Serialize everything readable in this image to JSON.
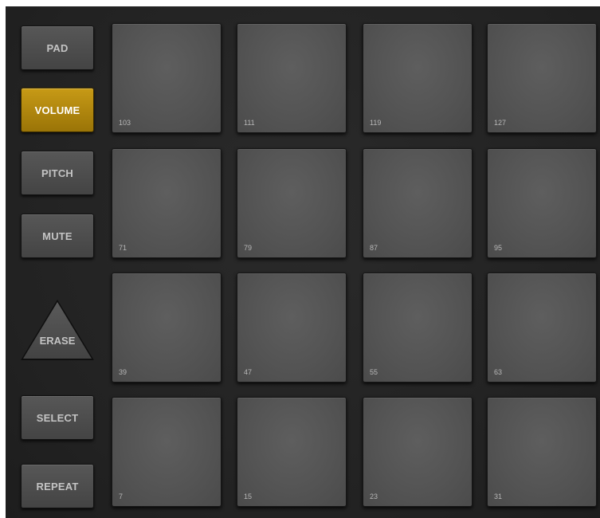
{
  "sidebar": {
    "buttons": [
      {
        "label": "PAD",
        "active": false
      },
      {
        "label": "VOLUME",
        "active": true
      },
      {
        "label": "PITCH",
        "active": false
      },
      {
        "label": "MUTE",
        "active": false
      }
    ],
    "erase_label": "ERASE",
    "select_label": "SELECT",
    "repeat_label": "REPEAT"
  },
  "pads": [
    {
      "number": "103"
    },
    {
      "number": "111"
    },
    {
      "number": "119"
    },
    {
      "number": "127"
    },
    {
      "number": "71"
    },
    {
      "number": "79"
    },
    {
      "number": "87"
    },
    {
      "number": "95"
    },
    {
      "number": "39"
    },
    {
      "number": "47"
    },
    {
      "number": "55"
    },
    {
      "number": "63"
    },
    {
      "number": "7"
    },
    {
      "number": "15"
    },
    {
      "number": "23"
    },
    {
      "number": "31"
    }
  ],
  "colors": {
    "background": "#242424",
    "button": "#4c4c4c",
    "active_button": "#b38a10",
    "pad": "#565656",
    "label": "#c4c4c4"
  }
}
